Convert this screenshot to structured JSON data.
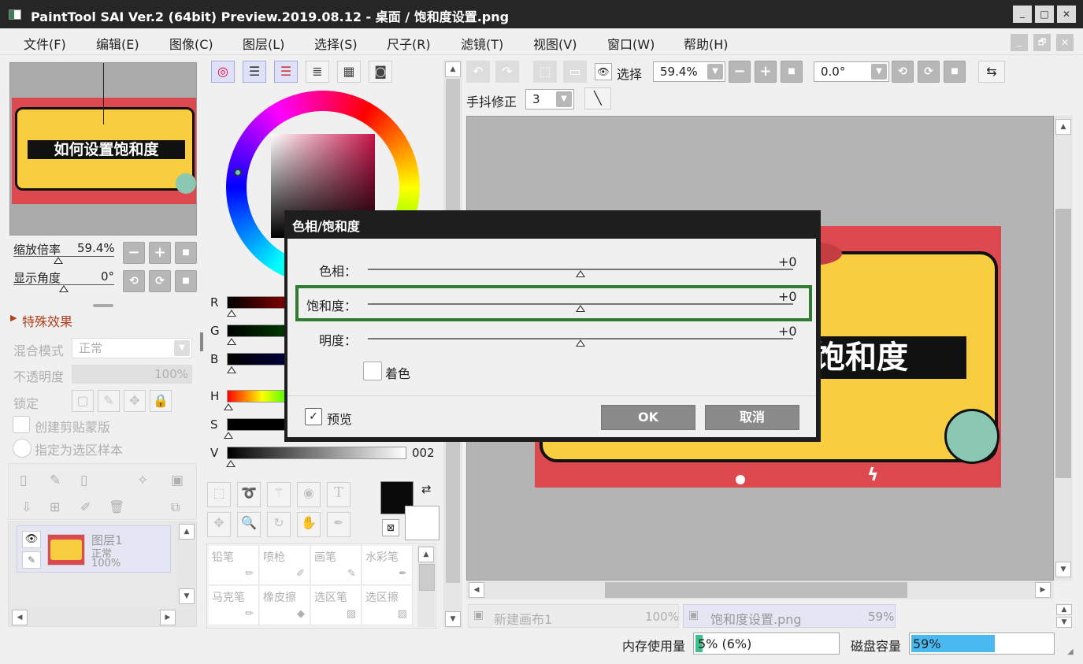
{
  "title_bar": {
    "title": "PaintTool SAI Ver.2 (64bit) Preview.2019.08.12 - 桌面 / 饱和度设置.png",
    "min": "_",
    "max": "□",
    "close": "✕"
  },
  "menu": [
    "文件(F)",
    "编辑(E)",
    "图像(C)",
    "图层(L)",
    "选择(S)",
    "尺子(R)",
    "滤镜(T)",
    "视图(V)",
    "窗口(W)",
    "帮助(H)"
  ],
  "mdi_buttons": {
    "min": "_",
    "restore": "🗗",
    "close": "✕"
  },
  "navigator": {
    "zoom_label": "缩放倍率",
    "zoom_value": "59.4%",
    "angle_label": "显示角度",
    "angle_value": "0°",
    "preview_text": "如何设置饱和度"
  },
  "effects": {
    "section": "特殊效果",
    "blend_label": "混合模式",
    "blend_value": "正常",
    "opacity_label": "不透明度",
    "opacity_value": "100%",
    "lock_label": "锁定",
    "clip_label": "创建剪贴蒙版",
    "sample_label": "指定为选区样本"
  },
  "layer": {
    "name": "图层1",
    "mode": "正常",
    "opacity": "100%"
  },
  "color_sliders": {
    "r": "R",
    "g": "G",
    "b": "B",
    "h": "H",
    "s": "S",
    "v": "V",
    "v_value": "002"
  },
  "brushes": [
    [
      "铅笔",
      "喷枪",
      "画笔",
      "水彩笔"
    ],
    [
      "马克笔",
      "橡皮擦",
      "选区笔",
      "选区擦"
    ]
  ],
  "toolbar": {
    "select_label": "选择",
    "zoom_value": "59.4%",
    "angle_value": "0.0°",
    "stabilizer_label": "手抖修正",
    "stabilizer_value": "3"
  },
  "canvas": {
    "big_text": "饱和度"
  },
  "dialog": {
    "title": "色相/饱和度",
    "hue_label": "色相：",
    "hue_value": "+0",
    "sat_label": "饱和度：",
    "sat_value": "+0",
    "light_label": "明度：",
    "light_value": "+0",
    "colorize_label": "着色",
    "preview_label": "预览",
    "ok_label": "OK",
    "cancel_label": "取消",
    "highlight_color": "#2f7d32"
  },
  "doc_tabs": [
    {
      "name": "新建画布1",
      "zoom": "100%"
    },
    {
      "name": "饱和度设置.png",
      "zoom": "59%"
    }
  ],
  "status": {
    "mem_label": "内存使用量",
    "mem_value": "5% (6%)",
    "mem_fraction": 0.05,
    "disk_label": "磁盘容量",
    "disk_value": "59%",
    "disk_fraction": 0.59
  },
  "colors": {
    "poster_red": "#dc4a4f",
    "poster_yellow": "#f8cd3f",
    "accent_blue": "#4ab9f0",
    "mem_green": "#3cc08c"
  }
}
